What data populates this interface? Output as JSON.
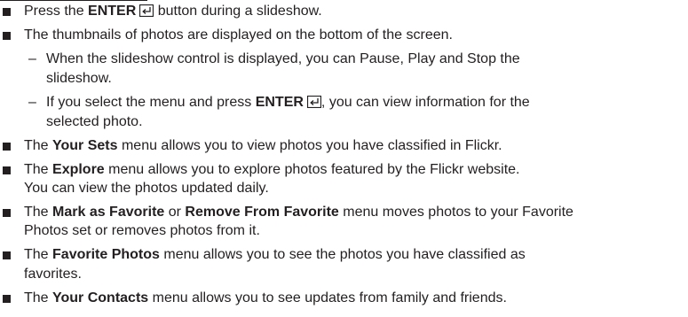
{
  "items": [
    {
      "parts": [
        "Press the ",
        "ENTER",
        " button during a slideshow."
      ]
    },
    {
      "text": "The thumbnails of photos are displayed on the bottom of the screen."
    },
    {
      "sub": [
        {
          "line1": "When the slideshow control is displayed, you can Pause, Play and Stop the",
          "line2": "slideshow."
        },
        {
          "parts": [
            "If you select the menu and press ",
            "ENTER",
            ", you can view information for the"
          ],
          "line2": "selected photo."
        }
      ]
    },
    {
      "parts": [
        "The ",
        "Your Sets",
        " menu allows you to view photos you have classified in Flickr."
      ]
    },
    {
      "parts": [
        "The ",
        "Explore",
        " menu allows you to explore photos featured by the Flickr website."
      ],
      "line2": "You can view the photos updated daily."
    },
    {
      "parts": [
        "The ",
        "Mark as Favorite",
        " or ",
        "Remove From Favorite",
        " menu moves photos to your Favorite"
      ],
      "line2": "Photos set or removes photos from it."
    },
    {
      "parts": [
        "The ",
        "Favorite Photos",
        " menu allows you to see the photos you have classified as"
      ],
      "line2": "favorites."
    },
    {
      "parts": [
        "The ",
        "Your Contacts",
        " menu allows you to see updates from family and friends."
      ]
    }
  ],
  "icons": {
    "enter": "enter-key-icon"
  }
}
